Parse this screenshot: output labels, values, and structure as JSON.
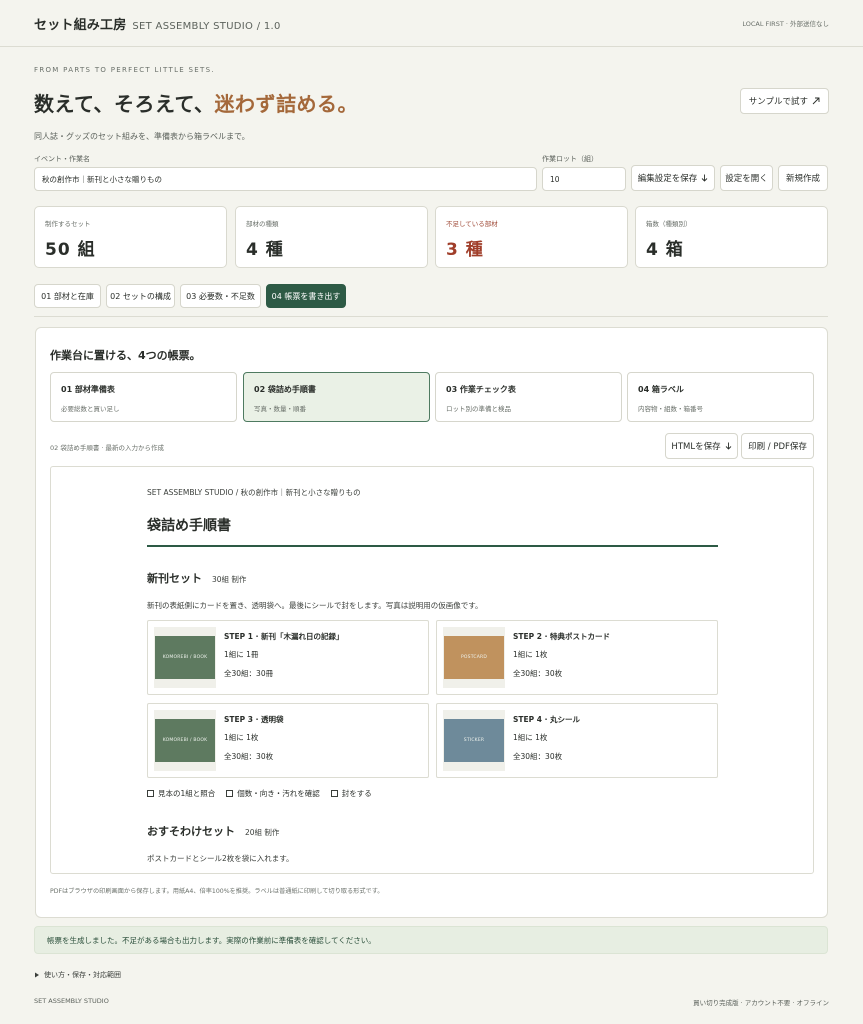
{
  "header": {
    "brand": "セット組み工房",
    "brand_sub": "SET ASSEMBLY STUDIO / 1.0",
    "note": "LOCAL FIRST · 外部送信なし"
  },
  "hero": {
    "eyebrow": "FROM PARTS TO PERFECT LITTLE SETS.",
    "headline_main": "数えて、そろえて、",
    "headline_accent": "迷わず詰める。",
    "subtitle": "同人誌・グッズのセット組みを、準備表から箱ラベルまで。",
    "sample_button": "サンプルで試す",
    "sample_icon": "arrow-up-right-icon"
  },
  "form": {
    "event_label": "イベント・作業名",
    "event_value": "秋の創作市｜新刊と小さな贈りもの",
    "lot_label": "作業ロット（組）",
    "lot_value": "10",
    "save_settings": "編集設定を保存",
    "open_settings": "設定を開く",
    "new_create": "新規作成"
  },
  "stats": [
    {
      "label": "制作するセット",
      "value": "50 組"
    },
    {
      "label": "部材の種類",
      "value": "4 種"
    },
    {
      "label": "不足している部材",
      "value": "3 種"
    },
    {
      "label": "箱数（種類別）",
      "value": "4 箱"
    }
  ],
  "tabs": [
    {
      "label": "01 部材と在庫"
    },
    {
      "label": "02 セットの構成"
    },
    {
      "label": "03 必要数・不足数"
    },
    {
      "label": "04 帳票を書き出す"
    }
  ],
  "panel": {
    "title": "作業台に置ける、4つの帳票。",
    "docs": [
      {
        "title": "01 部材準備表",
        "desc": "必要総数と買い足し"
      },
      {
        "title": "02 袋詰め手順書",
        "desc": "写真・数量・順番"
      },
      {
        "title": "03 作業チェック表",
        "desc": "ロット別の準備と検品"
      },
      {
        "title": "04 箱ラベル",
        "desc": "内容物・組数・箱番号"
      }
    ],
    "note": "02 袋詰め手順書 · 最新の入力から作成",
    "save_html": "HTMLを保存",
    "print_pdf": "印刷 / PDF保存",
    "footnote": "PDFはブラウザの印刷画面から保存します。用紙A4、倍率100%を推奨。ラベルは普通紙に印刷して切り取る形式です。"
  },
  "preview": {
    "header": "SET ASSEMBLY STUDIO / 秋の創作市｜新刊と小さな贈りもの",
    "title": "袋詰め手順書",
    "section1": {
      "title": "新刊セット",
      "count": "30組 制作",
      "desc": "新刊の表紙側にカードを置き、透明袋へ。最後にシールで封をします。写真は説明用の仮画像です。"
    },
    "steps": [
      {
        "title": "STEP 1 · 新刊「木漏れ日の記録」",
        "per": "1組に 1冊",
        "total": "全30組：30冊",
        "thumb": "KOMOREBI / BOOK",
        "color": "#5e7a60"
      },
      {
        "title": "STEP 2 · 特典ポストカード",
        "per": "1組に 1枚",
        "total": "全30組：30枚",
        "thumb": "POSTCARD",
        "color": "#c0925e"
      },
      {
        "title": "STEP 3 · 透明袋",
        "per": "1組に 1枚",
        "total": "全30組：30枚",
        "thumb": "KOMOREBI / BOOK",
        "color": "#5e7a60"
      },
      {
        "title": "STEP 4 · 丸シール",
        "per": "1組に 1枚",
        "total": "全30組：30枚",
        "thumb": "STICKER",
        "color": "#6e8a9a"
      }
    ],
    "checks": [
      "見本の1組と照合",
      "個数・向き・汚れを確認",
      "封をする"
    ],
    "section2": {
      "title": "おすそわけセット",
      "count": "20組 制作",
      "desc": "ポストカードとシール2枚を袋に入れます。"
    }
  },
  "status": "帳票を生成しました。不足がある場合も出力します。実際の作業前に準備表を確認してください。",
  "details": "使い方・保存・対応範囲",
  "footer": {
    "left": "SET ASSEMBLY STUDIO",
    "right": "買い切り完成版 · アカウント不要 · オフライン"
  },
  "colors": {
    "accent_green": "#2d5a45",
    "accent_orange": "#a4683a",
    "warn_red": "#a03e2a"
  }
}
